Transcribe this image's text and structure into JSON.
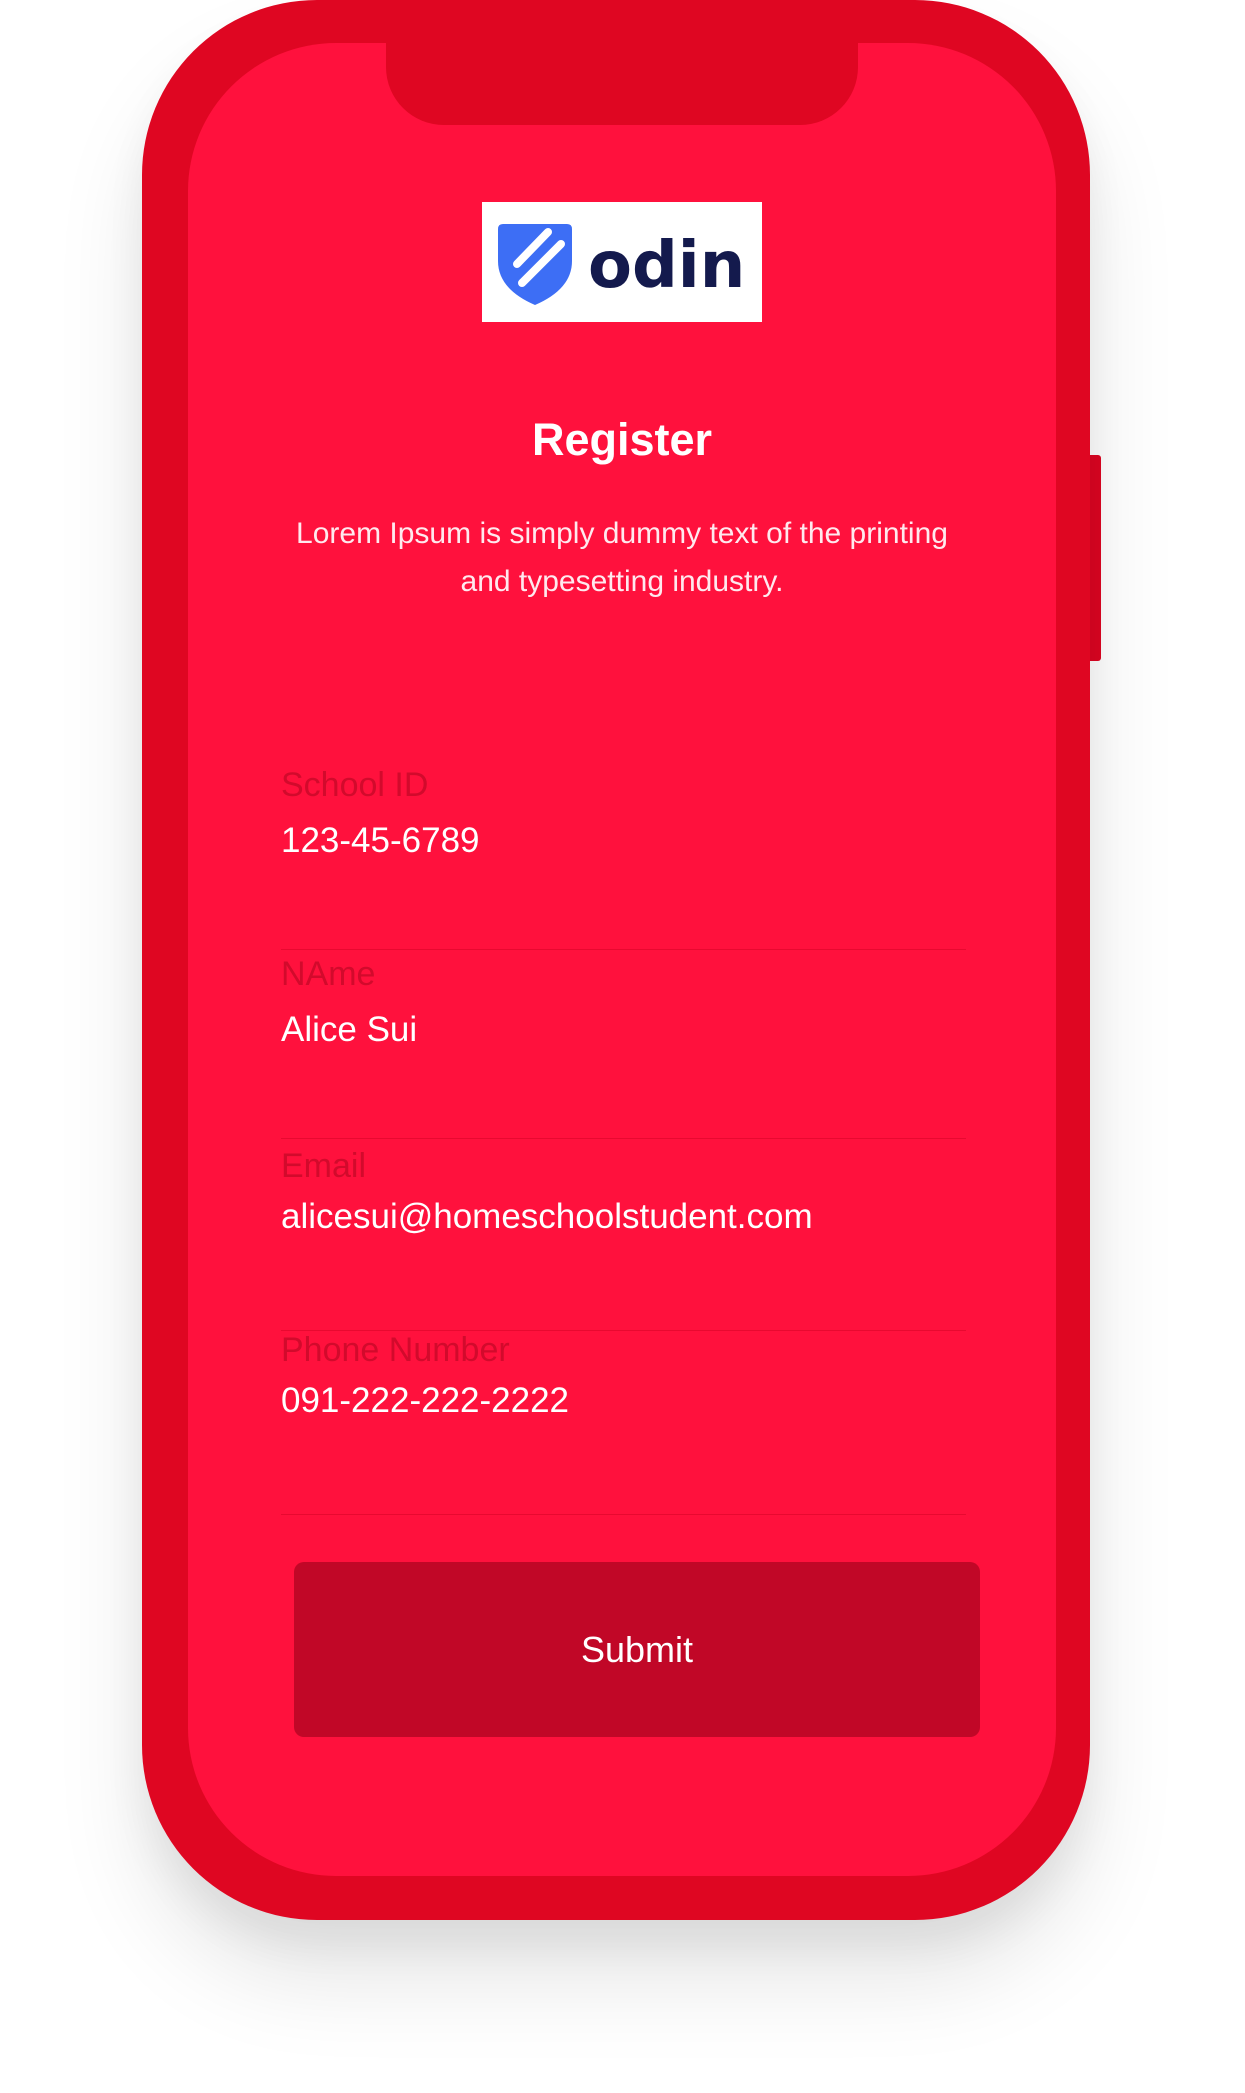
{
  "brand": {
    "logo_text": "odin",
    "logo_icon": "shield-icon",
    "logo_icon_color": "#3d6ef5",
    "logo_text_color": "#141a4d"
  },
  "page": {
    "title": "Register",
    "subtitle": "Lorem Ipsum is simply dummy text of the printing and typesetting industry."
  },
  "form": {
    "fields": [
      {
        "label": "School ID",
        "value": "123-45-6789"
      },
      {
        "label": "NAme",
        "value": "Alice Sui"
      },
      {
        "label": "Email",
        "value": "alicesui@homeschoolstudent.com"
      },
      {
        "label": "Phone Number",
        "value": "091-222-222-2222"
      }
    ],
    "submit_label": "Submit"
  },
  "colors": {
    "frame": "#df0622",
    "screen": "#ff113d",
    "button": "#c10727",
    "label": "#d20a2c",
    "text": "#ffffff"
  }
}
